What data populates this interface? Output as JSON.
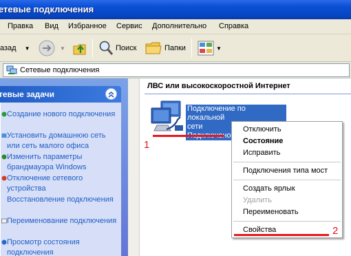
{
  "window": {
    "title": "етевые подключения"
  },
  "menu": [
    "Правка",
    "Вид",
    "Избранное",
    "Сервис",
    "Дополнительно",
    "Справка"
  ],
  "toolbar": {
    "back": "азад",
    "search": "Поиск",
    "folders": "Папки"
  },
  "address": {
    "value": "Сетевые подключения"
  },
  "sidebar": {
    "panel_title": "тевые задачи",
    "tasks": [
      {
        "label": "Создание нового подключения"
      },
      {
        "label": "Установить домашнюю сеть или сеть малого офиса"
      },
      {
        "label": "Изменить параметры брандмауэра Windows"
      },
      {
        "label": "Отключение сетевого устройства"
      },
      {
        "label": "Восстановление подключения"
      },
      {
        "label": "Переименование подключения"
      },
      {
        "label": "Просмотр состояния подключения"
      }
    ]
  },
  "content": {
    "group_header": "ЛВС или высокоскоростной Интернет",
    "connection_label_line1": "Подключение по локальной",
    "connection_label_line2": "сети",
    "connection_label_line3": "Подключено"
  },
  "context_menu": {
    "items": [
      "Отключить",
      "Состояние",
      "Исправить",
      "Подключения типа мост",
      "Создать ярлык",
      "Удалить",
      "Переименовать",
      "Свойства"
    ]
  },
  "annotations": {
    "marker1": "1",
    "marker2": "2"
  },
  "colors": {
    "title_blue": "#0a4fd4",
    "sidebar_blue": "#6375d6",
    "selection": "#316ac5",
    "annotation_red": "#e8141c"
  }
}
